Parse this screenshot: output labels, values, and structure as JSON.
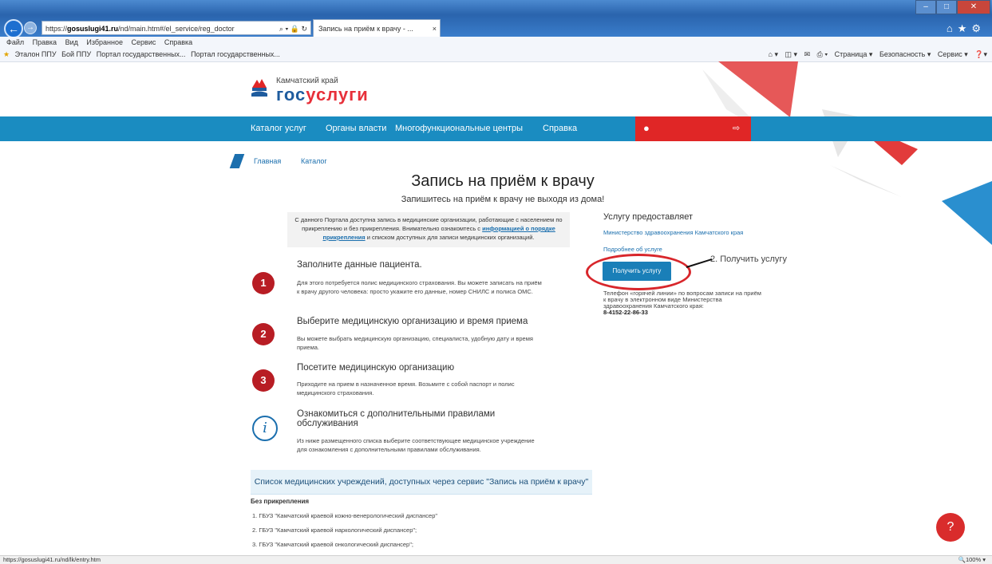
{
  "browser": {
    "url_prefix": "https://",
    "url_domain": "gosuslugi41.ru",
    "url_path": "/nd/main.htm#/el_service/reg_doctor",
    "addr_icons": "⌕ ▾ 🔒 ↻",
    "tab_title": "Запись на приём к врачу - ...",
    "menu": [
      "Файл",
      "Правка",
      "Вид",
      "Избранное",
      "Сервис",
      "Справка"
    ],
    "favorites": [
      "Эталон ППУ",
      "Бой ППУ",
      "Портал государственных...",
      "Портал государственных..."
    ],
    "commands": [
      "Страница ▾",
      "Безопасность ▾",
      "Сервис ▾"
    ],
    "status_url": "https://gosuslugi41.ru/nd/lk/entry.htm",
    "zoom": "100%"
  },
  "logo": {
    "region": "Камчатский край",
    "text_a": "гос",
    "text_b": "услуги"
  },
  "nav": [
    "Каталог услуг",
    "Органы власти",
    "Многофункциональные центры",
    "Справка"
  ],
  "breadcrumb": {
    "home": "Главная",
    "catalog": "Каталог"
  },
  "page": {
    "title": "Запись на приём к врачу",
    "subtitle": "Запишитесь на приём к врачу не выходя из дома!",
    "notice_1": "С данного Портала доступна запись в медицинские организации, работающие с населением по прикреплению и без прикрепления. Внимательно ознакомтесь с ",
    "notice_link": "информацией о порядке прикрепления",
    "notice_2": " и списком доступных для записи медицинских организаций."
  },
  "steps": [
    {
      "num": "1",
      "title": "Заполните данные пациента.",
      "text": "Для этого потребуется полис медицинского страхования. Вы можете записать на приём к врачу другого человека: просто укажите его данные, номер СНИЛС и полиса ОМС."
    },
    {
      "num": "2",
      "title": "Выберите медицинскую организацию и время приема",
      "text": "Вы можете выбрать медицинскую организацию, специалиста, удобную дату и время приема."
    },
    {
      "num": "3",
      "title": "Посетите медицинскую организацию",
      "text": "Приходите на прием в назначенное время. Возьмите с собой паспорт и полис медицинского страхования."
    },
    {
      "num": "i",
      "title": "Ознакомиться с дополнительными правилами обслуживания",
      "text": "Из ниже размещенного списка выберите соответствующее медицинское учреждение для ознакомления с дополнительными правилами обслуживания."
    }
  ],
  "list": {
    "header": "Список медицинских учреждений, доступных через сервис \"Запись на приём к врачу\"",
    "subheader": "Без прикрепления",
    "items": [
      "1.  ГБУЗ \"Камчатский краевой кожно-венерологический диспансер\"",
      "2.  ГБУЗ \"Камчатский краевой наркологический диспансер\";",
      "3.  ГБУЗ \"Камчатский краевой онкологический диспансер\";"
    ]
  },
  "provider": {
    "title": "Услугу предоставляет",
    "link": "Министерство здравоохранения Камчатского края",
    "more": "Подробнее об услуге",
    "button": "Получить услугу",
    "annotation": "2. Получить услугу",
    "phone_1": "Телефон «горячей линии» по вопросам записи на приём к врачу в электронном виде Министерства здравоохранения Камчатского края:",
    "phone_num": "8-4152-22-86-33"
  },
  "help_icon": "?",
  "colors": {
    "nav": "#1a8cc1",
    "accent_red": "#e02626",
    "button": "#1a7fb8",
    "step": "#b81d24"
  }
}
